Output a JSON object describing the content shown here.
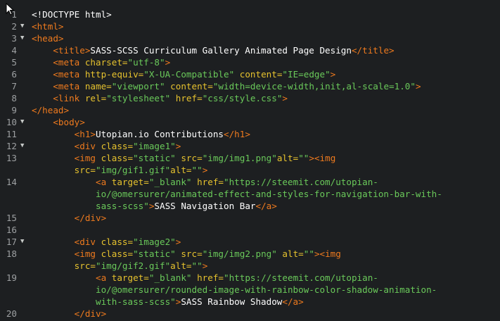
{
  "editor": {
    "lines": [
      {
        "num": "1",
        "fold": "",
        "indent": "",
        "tokens": [
          {
            "t": "txt",
            "v": "<!DOCTYPE html>"
          }
        ]
      },
      {
        "num": "2",
        "fold": "▼",
        "indent": "",
        "tokens": [
          {
            "t": "tag",
            "v": "<html>"
          }
        ]
      },
      {
        "num": "3",
        "fold": "▼",
        "indent": "",
        "tokens": [
          {
            "t": "tag",
            "v": "<head>"
          }
        ]
      },
      {
        "num": "4",
        "fold": "",
        "indent": "    ",
        "tokens": [
          {
            "t": "tag",
            "v": "<title>"
          },
          {
            "t": "txt",
            "v": "SASS-SCSS Curriculum Gallery Animated Page Design"
          },
          {
            "t": "tag",
            "v": "</title>"
          }
        ]
      },
      {
        "num": "5",
        "fold": "",
        "indent": "    ",
        "tokens": [
          {
            "t": "tag",
            "v": "<meta "
          },
          {
            "t": "attr",
            "v": "charset="
          },
          {
            "t": "str",
            "v": "\"utf-8\""
          },
          {
            "t": "tag",
            "v": ">"
          }
        ]
      },
      {
        "num": "6",
        "fold": "",
        "indent": "    ",
        "tokens": [
          {
            "t": "tag",
            "v": "<meta "
          },
          {
            "t": "attr",
            "v": "http-equiv="
          },
          {
            "t": "str",
            "v": "\"X-UA-Compatible\""
          },
          {
            "t": "attr",
            "v": " content="
          },
          {
            "t": "str",
            "v": "\"IE=edge\""
          },
          {
            "t": "tag",
            "v": ">"
          }
        ]
      },
      {
        "num": "7",
        "fold": "",
        "indent": "    ",
        "tokens": [
          {
            "t": "tag",
            "v": "<meta "
          },
          {
            "t": "attr",
            "v": "name="
          },
          {
            "t": "str",
            "v": "\"viewport\""
          },
          {
            "t": "attr",
            "v": " content="
          },
          {
            "t": "str",
            "v": "\"width=device-width,init,al-scale=1.0\""
          },
          {
            "t": "tag",
            "v": ">"
          }
        ]
      },
      {
        "num": "8",
        "fold": "",
        "indent": "    ",
        "tokens": [
          {
            "t": "tag",
            "v": "<link "
          },
          {
            "t": "attr",
            "v": "rel="
          },
          {
            "t": "str",
            "v": "\"stylesheet\""
          },
          {
            "t": "attr",
            "v": " href="
          },
          {
            "t": "str",
            "v": "\"css/style.css\""
          },
          {
            "t": "tag",
            "v": ">"
          }
        ]
      },
      {
        "num": "9",
        "fold": "",
        "indent": "",
        "tokens": [
          {
            "t": "tag",
            "v": "</head>"
          }
        ]
      },
      {
        "num": "10",
        "fold": "▼",
        "indent": "    ",
        "tokens": [
          {
            "t": "tag",
            "v": "<body>"
          }
        ]
      },
      {
        "num": "11",
        "fold": "",
        "indent": "        ",
        "tokens": [
          {
            "t": "tag",
            "v": "<h1>"
          },
          {
            "t": "txt",
            "v": "Utopian.io Contributions"
          },
          {
            "t": "tag",
            "v": "</h1>"
          }
        ]
      },
      {
        "num": "12",
        "fold": "▼",
        "indent": "        ",
        "tokens": [
          {
            "t": "tag",
            "v": "<div "
          },
          {
            "t": "attr",
            "v": "class="
          },
          {
            "t": "str",
            "v": "\"image1\""
          },
          {
            "t": "tag",
            "v": ">"
          }
        ]
      },
      {
        "num": "13",
        "fold": "",
        "indent": "        ",
        "tokens": [
          {
            "t": "tag",
            "v": "<img "
          },
          {
            "t": "attr",
            "v": "class="
          },
          {
            "t": "str",
            "v": "\"static\""
          },
          {
            "t": "attr",
            "v": " src="
          },
          {
            "t": "str",
            "v": "\"img/img1.png\""
          },
          {
            "t": "attr",
            "v": "alt="
          },
          {
            "t": "str",
            "v": "\"\""
          },
          {
            "t": "tag",
            "v": "><img"
          }
        ]
      },
      {
        "num": "",
        "fold": "",
        "indent": "        ",
        "tokens": [
          {
            "t": "attr",
            "v": "src="
          },
          {
            "t": "str",
            "v": "\"img/gif1.gif\""
          },
          {
            "t": "attr",
            "v": "alt="
          },
          {
            "t": "str",
            "v": "\"\""
          },
          {
            "t": "tag",
            "v": ">"
          }
        ]
      },
      {
        "num": "14",
        "fold": "",
        "indent": "            ",
        "tokens": [
          {
            "t": "tag",
            "v": "<a "
          },
          {
            "t": "attr",
            "v": "target="
          },
          {
            "t": "str",
            "v": "\"_blank\""
          },
          {
            "t": "attr",
            "v": " href="
          },
          {
            "t": "str",
            "v": "\"https://steemit.com/utopian-"
          }
        ]
      },
      {
        "num": "",
        "fold": "",
        "indent": "            ",
        "tokens": [
          {
            "t": "str",
            "v": "io/@omersurer/animated-effect-and-styles-for-navigation-bar-with-"
          }
        ]
      },
      {
        "num": "",
        "fold": "",
        "indent": "            ",
        "tokens": [
          {
            "t": "str",
            "v": "sass-scss\""
          },
          {
            "t": "tag",
            "v": ">"
          },
          {
            "t": "txt",
            "v": "SASS Navigation Bar"
          },
          {
            "t": "tag",
            "v": "</a>"
          }
        ]
      },
      {
        "num": "15",
        "fold": "",
        "indent": "        ",
        "tokens": [
          {
            "t": "tag",
            "v": "</div>"
          }
        ]
      },
      {
        "num": "16",
        "fold": "",
        "indent": "",
        "tokens": []
      },
      {
        "num": "17",
        "fold": "▼",
        "indent": "        ",
        "tokens": [
          {
            "t": "tag",
            "v": "<div "
          },
          {
            "t": "attr",
            "v": "class="
          },
          {
            "t": "str",
            "v": "\"image2\""
          },
          {
            "t": "tag",
            "v": ">"
          }
        ]
      },
      {
        "num": "18",
        "fold": "",
        "indent": "        ",
        "tokens": [
          {
            "t": "tag",
            "v": "<img "
          },
          {
            "t": "attr",
            "v": "class="
          },
          {
            "t": "str",
            "v": "\"static\""
          },
          {
            "t": "attr",
            "v": " src="
          },
          {
            "t": "str",
            "v": "\"img/img2.png\""
          },
          {
            "t": "attr",
            "v": " alt="
          },
          {
            "t": "str",
            "v": "\"\""
          },
          {
            "t": "tag",
            "v": "><img"
          }
        ]
      },
      {
        "num": "",
        "fold": "",
        "indent": "        ",
        "tokens": [
          {
            "t": "attr",
            "v": "src="
          },
          {
            "t": "str",
            "v": "\"img/gif2.gif\""
          },
          {
            "t": "attr",
            "v": "alt="
          },
          {
            "t": "str",
            "v": "\"\""
          },
          {
            "t": "tag",
            "v": ">"
          }
        ]
      },
      {
        "num": "19",
        "fold": "",
        "indent": "            ",
        "tokens": [
          {
            "t": "tag",
            "v": "<a "
          },
          {
            "t": "attr",
            "v": "target="
          },
          {
            "t": "str",
            "v": "\"_blank\""
          },
          {
            "t": "attr",
            "v": " href="
          },
          {
            "t": "str",
            "v": "\"https://steemit.com/utopian-"
          }
        ]
      },
      {
        "num": "",
        "fold": "",
        "indent": "            ",
        "tokens": [
          {
            "t": "str",
            "v": "io/@omersurer/rounded-image-with-rainbow-color-shadow-animation-"
          }
        ]
      },
      {
        "num": "",
        "fold": "",
        "indent": "            ",
        "tokens": [
          {
            "t": "str",
            "v": "with-sass-scss\""
          },
          {
            "t": "tag",
            "v": ">"
          },
          {
            "t": "txt",
            "v": "SASS Rainbow Shadow"
          },
          {
            "t": "tag",
            "v": "</a>"
          }
        ]
      },
      {
        "num": "20",
        "fold": "",
        "indent": "        ",
        "tokens": [
          {
            "t": "tag",
            "v": "</div>"
          }
        ]
      }
    ]
  },
  "colors": {
    "background": "#1d1f21",
    "tag": "#ee7a1e",
    "attribute": "#e6c22e",
    "string": "#6ac95a",
    "text": "#ffffff",
    "line_number": "#9da0a2"
  },
  "icons": {
    "cursor": "mouse-pointer-icon",
    "fold": "fold-arrow-icon"
  }
}
